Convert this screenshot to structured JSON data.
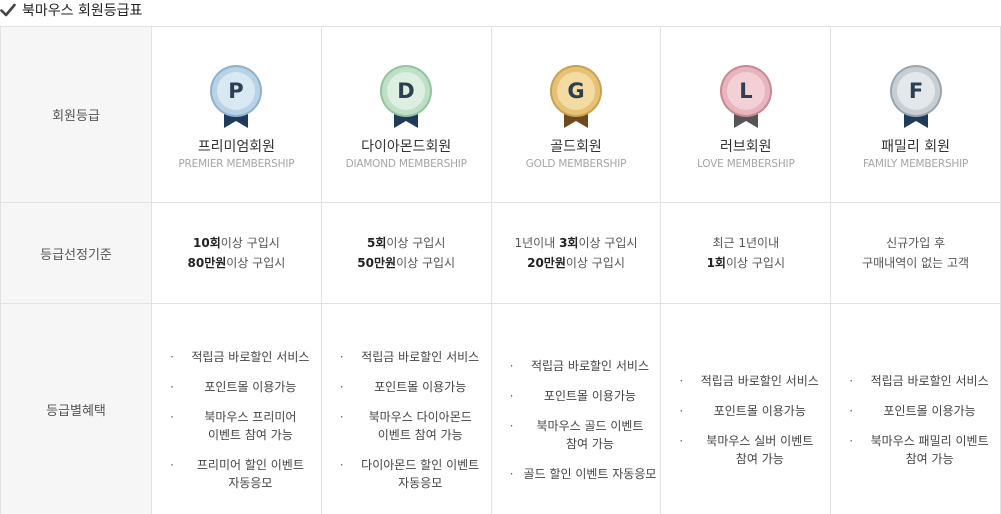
{
  "title": "북마우스 회원등급표",
  "row_headers": {
    "grade": "회원등급",
    "criteria": "등급선정기준",
    "benefits": "등급별혜택"
  },
  "levels": [
    {
      "letter": "P",
      "name": "프리미엄회원",
      "en": "PREMIER MEMBERSHIP",
      "colors": {
        "outer": "#b9d2e6",
        "inner": "#d9e9f4",
        "rim": "#8fb1cc",
        "ribbon": "#1f3a5a"
      },
      "criteria": [
        {
          "b": "10회",
          "t": "이상 구입시"
        },
        {
          "b": "80만원",
          "t": "이상 구입시"
        }
      ],
      "benefits": [
        "적립금 바로할인 서비스",
        "포인트몰 이용가능",
        "북마우스 프리미어\n이벤트 참여 가능",
        "프리미어 할인 이벤트\n자동응모"
      ]
    },
    {
      "letter": "D",
      "name": "다이아몬드회원",
      "en": "DIAMOND MEMBERSHIP",
      "colors": {
        "outer": "#bfe0c7",
        "inner": "#dcefe0",
        "rim": "#92c49e",
        "ribbon": "#1f3a5a"
      },
      "criteria": [
        {
          "b": "5회",
          "t": "이상 구입시"
        },
        {
          "b": "50만원",
          "t": "이상 구입시"
        }
      ],
      "benefits": [
        "적립금 바로할인 서비스",
        "포인트몰 이용가능",
        "북마우스 다이아몬드\n이벤트 참여 가능",
        "다이아몬드 할인 이벤트\n자동응모"
      ]
    },
    {
      "letter": "G",
      "name": "골드회원",
      "en": "GOLD MEMBERSHIP",
      "colors": {
        "outer": "#e6c277",
        "inner": "#f3dba2",
        "rim": "#c9a04f",
        "ribbon": "#6b4a22"
      },
      "criteria": [
        {
          "p": "1년이내 ",
          "b": "3회",
          "t": "이상 구입시"
        },
        {
          "b": "20만원",
          "t": "이상 구입시"
        }
      ],
      "benefits": [
        "적립금 바로할인 서비스",
        "포인트몰 이용가능",
        "북마우스 골드 이벤트\n참여 가능",
        "골드 할인 이벤트 자동응모"
      ]
    },
    {
      "letter": "L",
      "name": "러브회원",
      "en": "LOVE MEMBERSHIP",
      "colors": {
        "outer": "#e8b4bd",
        "inner": "#f3d0d6",
        "rim": "#c98893",
        "ribbon": "#555555"
      },
      "criteria": [
        {
          "t": "최근 1년이내"
        },
        {
          "b": "1회",
          "t": "이상 구입시"
        }
      ],
      "benefits": [
        "적립금 바로할인 서비스",
        "포인트몰 이용가능",
        "북마우스 실버 이벤트\n참여 가능"
      ]
    },
    {
      "letter": "F",
      "name": "패밀리 회원",
      "en": "FAMILY MEMBERSHIP",
      "colors": {
        "outer": "#c7ced4",
        "inner": "#e3e8ec",
        "rim": "#9ba6ae",
        "ribbon": "#1f3a5a"
      },
      "criteria": [
        {
          "t": "신규가입 후"
        },
        {
          "t": "구매내역이 없는 고객"
        }
      ],
      "benefits": [
        "적립금 바로할인 서비스",
        "포인트몰 이용가능",
        "북마우스 패밀리 이벤트\n참여 가능"
      ]
    }
  ]
}
